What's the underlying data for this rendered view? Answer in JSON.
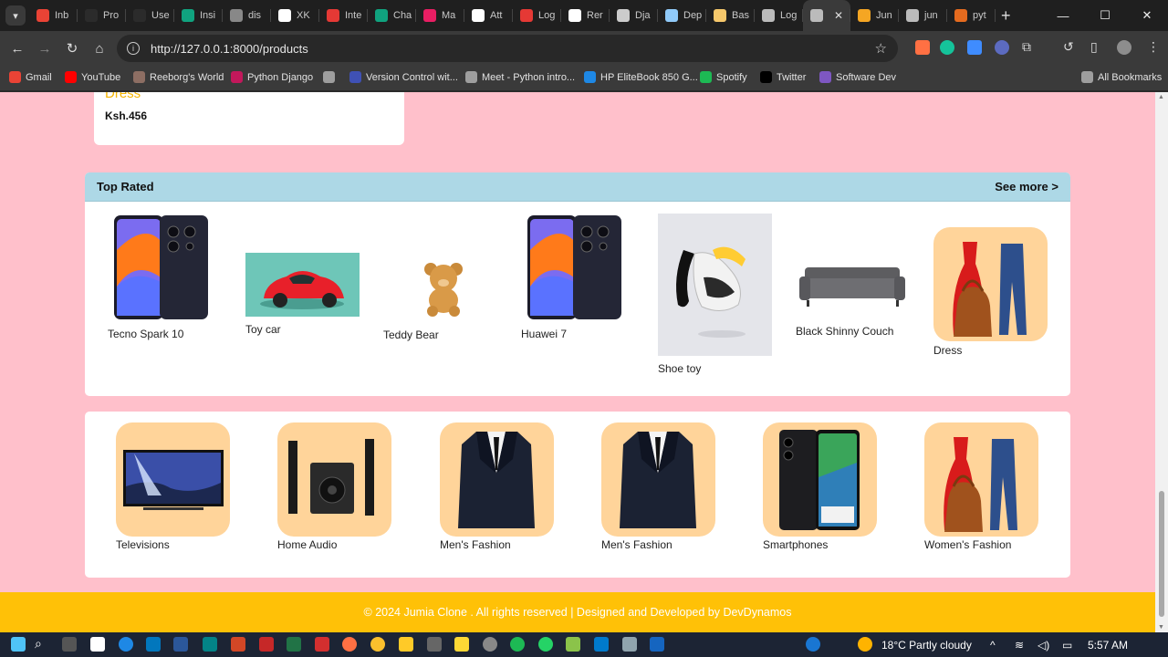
{
  "browser": {
    "tabs": [
      {
        "label": "Inb",
        "color": "#ea4335"
      },
      {
        "label": "Pro",
        "color": "#2b2b2b"
      },
      {
        "label": "Use",
        "color": "#2b2b2b"
      },
      {
        "label": "Insi",
        "color": "#10a37f"
      },
      {
        "label": "dis",
        "color": "#888888"
      },
      {
        "label": "XK",
        "color": "#ffffff"
      },
      {
        "label": "Inte",
        "color": "#e53935"
      },
      {
        "label": "Cha",
        "color": "#10a37f"
      },
      {
        "label": "Ma",
        "color": "#e91e63"
      },
      {
        "label": "Att",
        "color": "#ffffff"
      },
      {
        "label": "Log",
        "color": "#e53935"
      },
      {
        "label": "Rer",
        "color": "#ffffff"
      },
      {
        "label": "Dja",
        "color": "#cccccc"
      },
      {
        "label": "Dep",
        "color": "#90caf9"
      },
      {
        "label": "Bas",
        "color": "#f6c86b"
      },
      {
        "label": "Log",
        "color": "#bbbbbb"
      },
      {
        "label": "",
        "color": "#bbbbbb",
        "active": true
      },
      {
        "label": "Jun",
        "color": "#f5a623"
      },
      {
        "label": "jun",
        "color": "#bbbbbb"
      },
      {
        "label": "pyt",
        "color": "#e56b1f"
      }
    ],
    "url": "http://127.0.0.1:8000/products",
    "bookmarks": [
      {
        "label": "Gmail",
        "color": "#ea4335"
      },
      {
        "label": "YouTube",
        "color": "#ff0000"
      },
      {
        "label": "Reeborg's World",
        "color": "#8d6e63"
      },
      {
        "label": "Python Django",
        "color": "#c2185b"
      },
      {
        "label": "",
        "color": "#9e9e9e"
      },
      {
        "label": "Version Control wit...",
        "color": "#3f51b5"
      },
      {
        "label": "Meet - Python intro...",
        "color": "#9e9e9e"
      },
      {
        "label": "HP EliteBook 850 G...",
        "color": "#1e88e5"
      },
      {
        "label": "Spotify",
        "color": "#1db954"
      },
      {
        "label": "Twitter",
        "color": "#000000"
      },
      {
        "label": "Software Dev",
        "color": "#7e57c2"
      },
      {
        "label": "All Bookmarks",
        "color": "#9e9e9e"
      }
    ]
  },
  "page": {
    "card": {
      "name": "Dress",
      "price": "Ksh.456"
    },
    "top_rated": {
      "title": "Top Rated",
      "see_more": "See more >",
      "items": [
        {
          "name": "Tecno Spark 10"
        },
        {
          "name": "Toy car"
        },
        {
          "name": "Teddy Bear"
        },
        {
          "name": "Huawei 7"
        },
        {
          "name": "Shoe toy"
        },
        {
          "name": "Black Shinny Couch"
        },
        {
          "name": "Dress"
        }
      ]
    },
    "categories": [
      {
        "name": "Televisions"
      },
      {
        "name": "Home Audio"
      },
      {
        "name": "Men's Fashion"
      },
      {
        "name": "Men's Fashion"
      },
      {
        "name": "Smartphones"
      },
      {
        "name": "Women's Fashion"
      }
    ],
    "footer": "© 2024 Jumia Clone . All rights reserved | Designed and Developed by DevDynamos"
  },
  "taskbar": {
    "weather": "18°C  Partly cloudy",
    "time": "5:57 AM"
  },
  "colors": {
    "page_bg": "#ffc0cb",
    "header_bg": "#add8e6",
    "footer_bg": "#ffc107",
    "accent": "#f5b400"
  }
}
